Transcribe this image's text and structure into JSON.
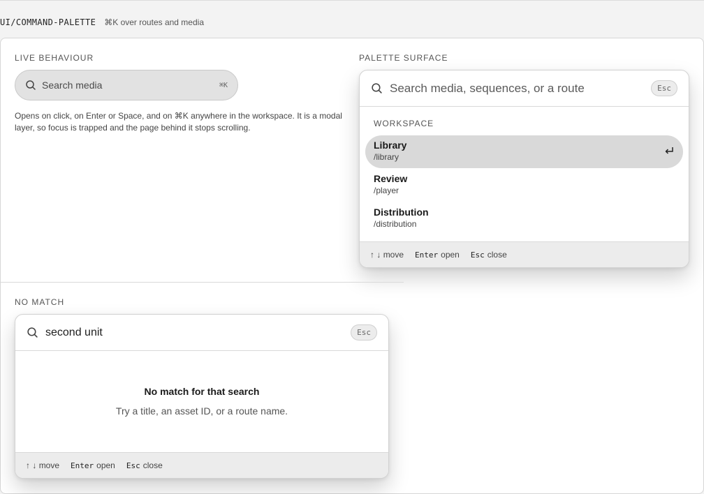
{
  "header": {
    "title": "UI/COMMAND-PALETTE",
    "subtitle": "⌘K over routes and media"
  },
  "live": {
    "label": "LIVE BEHAVIOUR",
    "trigger": {
      "placeholder": "Search media",
      "shortcut": "⌘K",
      "icon": "search-icon"
    },
    "description": "Opens on click, on Enter or Space, and on ⌘K anywhere in the workspace. It is a modal layer, so focus is trapped and the page behind it stops scrolling."
  },
  "surface": {
    "label": "PALETTE SURFACE",
    "search_placeholder": "Search media, sequences, or a route",
    "esc_label": "Esc",
    "group_label": "WORKSPACE",
    "items": [
      {
        "name": "Library",
        "route": "/library",
        "active": true
      },
      {
        "name": "Review",
        "route": "/player",
        "active": false
      },
      {
        "name": "Distribution",
        "route": "/distribution",
        "active": false
      }
    ],
    "footer": {
      "move_keys": "↑ ↓",
      "move_label": "move",
      "open_key": "Enter",
      "open_label": "open",
      "close_key": "Esc",
      "close_label": "close"
    }
  },
  "no_match": {
    "label": "NO MATCH",
    "query": "second unit",
    "esc_label": "Esc",
    "empty_title": "No match for that search",
    "empty_hint": "Try a title, an asset ID, or a route name.",
    "footer": {
      "move_keys": "↑ ↓",
      "move_label": "move",
      "open_key": "Enter",
      "open_label": "open",
      "close_key": "Esc",
      "close_label": "close"
    }
  },
  "colors": {
    "active_item": "#d9d9d9",
    "trigger_bg": "#e2e2e2",
    "footer_bg": "#ececec"
  }
}
